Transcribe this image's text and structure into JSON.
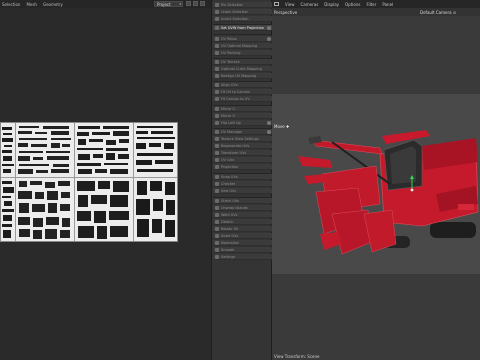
{
  "uv_editor": {
    "menu": [
      "Selection",
      "Mesh",
      "Geometry"
    ],
    "dropdown_value": "Project"
  },
  "tools": [
    {
      "label": "Pin Selection",
      "active": false,
      "radio": false
    },
    {
      "label": "Unpin Selection",
      "active": false,
      "radio": false
    },
    {
      "label": "Invert Selection",
      "active": false,
      "radio": false
    },
    {
      "label": "Set UVW from Projection",
      "active": true,
      "radio": true
    },
    {
      "label": "UV Relax",
      "active": false,
      "radio": true
    },
    {
      "label": "UV Optimal Mapping",
      "active": false,
      "radio": false
    },
    {
      "label": "UV Packing",
      "active": false,
      "radio": false
    },
    {
      "label": "UV Terrace",
      "active": false,
      "radio": false
    },
    {
      "label": "Optimal Cubic Mapping",
      "active": false,
      "radio": false
    },
    {
      "label": "Realign UV Mapping",
      "active": false,
      "radio": false
    },
    {
      "label": "Align UVs",
      "active": false,
      "radio": false
    },
    {
      "label": "Fit UV to Canvas",
      "active": false,
      "radio": false
    },
    {
      "label": "Fit Canvas to UV",
      "active": false,
      "radio": false
    },
    {
      "label": "Mirror U",
      "active": false,
      "radio": false
    },
    {
      "label": "Mirror V",
      "active": false,
      "radio": false
    },
    {
      "label": "Flip Left Up",
      "active": false,
      "radio": true
    },
    {
      "label": "UV Manager",
      "active": false,
      "radio": true
    },
    {
      "label": "Texture View Settings",
      "active": false,
      "radio": false
    },
    {
      "label": "Regenerate UVs",
      "active": false,
      "radio": false
    },
    {
      "label": "Transform UVs",
      "active": false,
      "radio": false
    },
    {
      "label": "UV Grid",
      "active": false,
      "radio": false
    },
    {
      "label": "Projection",
      "active": false,
      "radio": false
    },
    {
      "label": "Snap UVs",
      "active": false,
      "radio": false
    },
    {
      "label": "Checker",
      "active": false,
      "radio": false
    },
    {
      "label": "Sew UVs",
      "active": false,
      "radio": false
    },
    {
      "label": "Stitch UVs",
      "active": false,
      "radio": false
    },
    {
      "label": "Unwrap Islands",
      "active": false,
      "radio": false
    },
    {
      "label": "Weld UVs",
      "active": false,
      "radio": false
    },
    {
      "label": "Detach",
      "active": false,
      "radio": false
    },
    {
      "label": "Rotate 90",
      "active": false,
      "radio": false
    },
    {
      "label": "Scale UVs",
      "active": false,
      "radio": false
    },
    {
      "label": "Normalize",
      "active": false,
      "radio": false
    },
    {
      "label": "Smooth",
      "active": false,
      "radio": false
    },
    {
      "label": "Settings",
      "active": false,
      "radio": false
    }
  ],
  "viewport": {
    "menu": [
      "View",
      "Cameras",
      "Display",
      "Options",
      "Filter",
      "Panel"
    ],
    "perspective": "Perspective",
    "camera": "Default Camera ⊙",
    "mode": "Move ✚",
    "status": "View Transform: Scene"
  },
  "colors": {
    "model_red": "#c81a2c",
    "model_dark": "#2a2a2a"
  }
}
